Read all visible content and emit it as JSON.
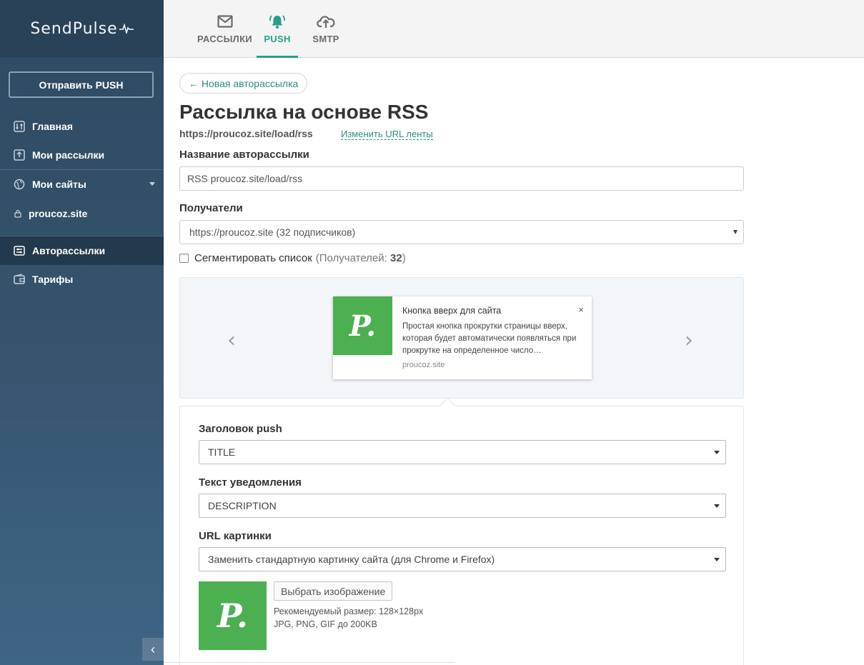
{
  "brand": {
    "name": "SendPulse",
    "pulse_glyph": "√–"
  },
  "sidebar": {
    "send_button": "Отправить PUSH",
    "items": [
      {
        "label": "Главная",
        "icon": "sliders-icon"
      },
      {
        "label": "Мои рассылки",
        "icon": "upload-box-icon"
      },
      {
        "label": "Мои сайты",
        "icon": "globe-icon"
      },
      {
        "label": "proucoz.site",
        "icon": "lock-icon"
      },
      {
        "label": "Авторассылки",
        "icon": "autoresponder-icon"
      },
      {
        "label": "Тарифы",
        "icon": "wallet-icon"
      }
    ],
    "collapse_glyph": "‹"
  },
  "topnav": {
    "tabs": [
      {
        "label": "РАССЫЛКИ",
        "icon": "envelope-icon"
      },
      {
        "label": "PUSH",
        "icon": "bell-icon"
      },
      {
        "label": "SMTP",
        "icon": "cloud-upload-icon"
      }
    ]
  },
  "main": {
    "back_button": "← Новая авторассылка",
    "title": "Рассылка на основе RSS",
    "feed_url": "https://proucoz.site/load/rss",
    "change_url": "Изменить URL ленты",
    "name_label": "Название авторассылки",
    "name_value": "RSS proucoz.site/load/rss",
    "recipients_label": "Получатели",
    "recipients_value": "https://proucoz.site (32 подписчиков)",
    "segment_label": "Сегментировать список",
    "segment_count_prefix": "(Получателей:",
    "segment_count": "32",
    "segment_count_suffix": ")"
  },
  "preview": {
    "prev_glyph": "‹",
    "next_glyph": "›",
    "logo_letter": "P.",
    "title": "Кнопка вверх для сайта",
    "close_glyph": "×",
    "text": "Простая кнопка прокрутки страницы вверх, которая будет автоматически появляться при прокрутке на определенное число…",
    "domain": "proucoz.site"
  },
  "form": {
    "push_title_label": "Заголовок push",
    "push_title_value": "TITLE",
    "text_label": "Текст уведомления",
    "text_value": "DESCRIPTION",
    "image_url_label": "URL картинки",
    "image_url_value": "Заменить стандартную картинку сайта (для Chrome и Firefox)",
    "image_logo_letter": "P.",
    "choose_image": "Выбрать изображение",
    "hint_size": "Рекомендуемый размер: 128×128px",
    "hint_formats": "JPG, PNG, GIF до 200KB"
  },
  "colors": {
    "accent": "#27a08b",
    "sidebar": "#2f4a62",
    "green": "#4caf50"
  }
}
